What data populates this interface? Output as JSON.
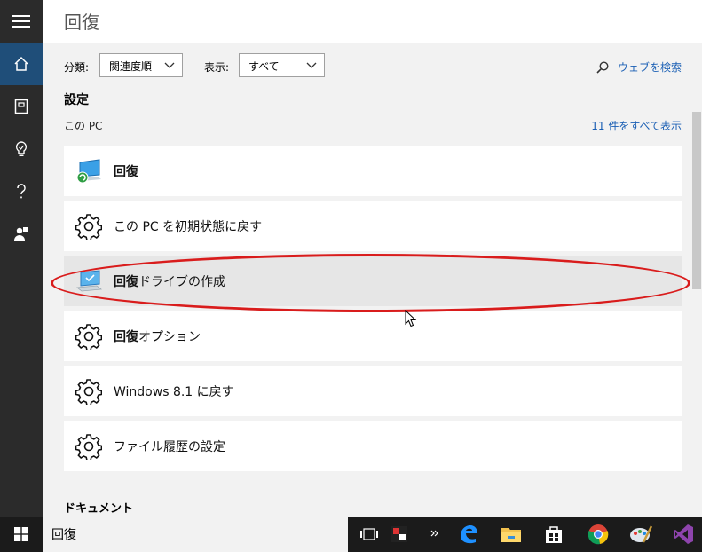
{
  "header": {
    "title": "回復"
  },
  "filters": {
    "sort_label": "分類:",
    "sort_value": "関連度順",
    "show_label": "表示:",
    "show_value": "すべて"
  },
  "web_search": "ウェブを検索",
  "settings": {
    "heading": "設定",
    "scope": "この PC",
    "see_all": "11 件をすべて表示",
    "items": [
      {
        "bold": "回復",
        "rest": "",
        "icon": "recovery-pc-icon"
      },
      {
        "bold": "",
        "rest": "この PC を初期状態に戻す",
        "icon": "gear-icon"
      },
      {
        "bold": "回復",
        "rest": "ドライブの作成",
        "icon": "recovery-drive-icon"
      },
      {
        "bold": "回復",
        "rest": "オプション",
        "icon": "gear-icon"
      },
      {
        "bold": "",
        "rest": "Windows 8.1 に戻す",
        "icon": "gear-icon"
      },
      {
        "bold": "",
        "rest": "ファイル履歴の設定",
        "icon": "gear-icon"
      }
    ]
  },
  "documents_heading": "ドキュメント",
  "search_query": "回復",
  "colors": {
    "accent": "#1f4e79",
    "link": "#1a5fb4",
    "highlight": "#d91c1c"
  }
}
